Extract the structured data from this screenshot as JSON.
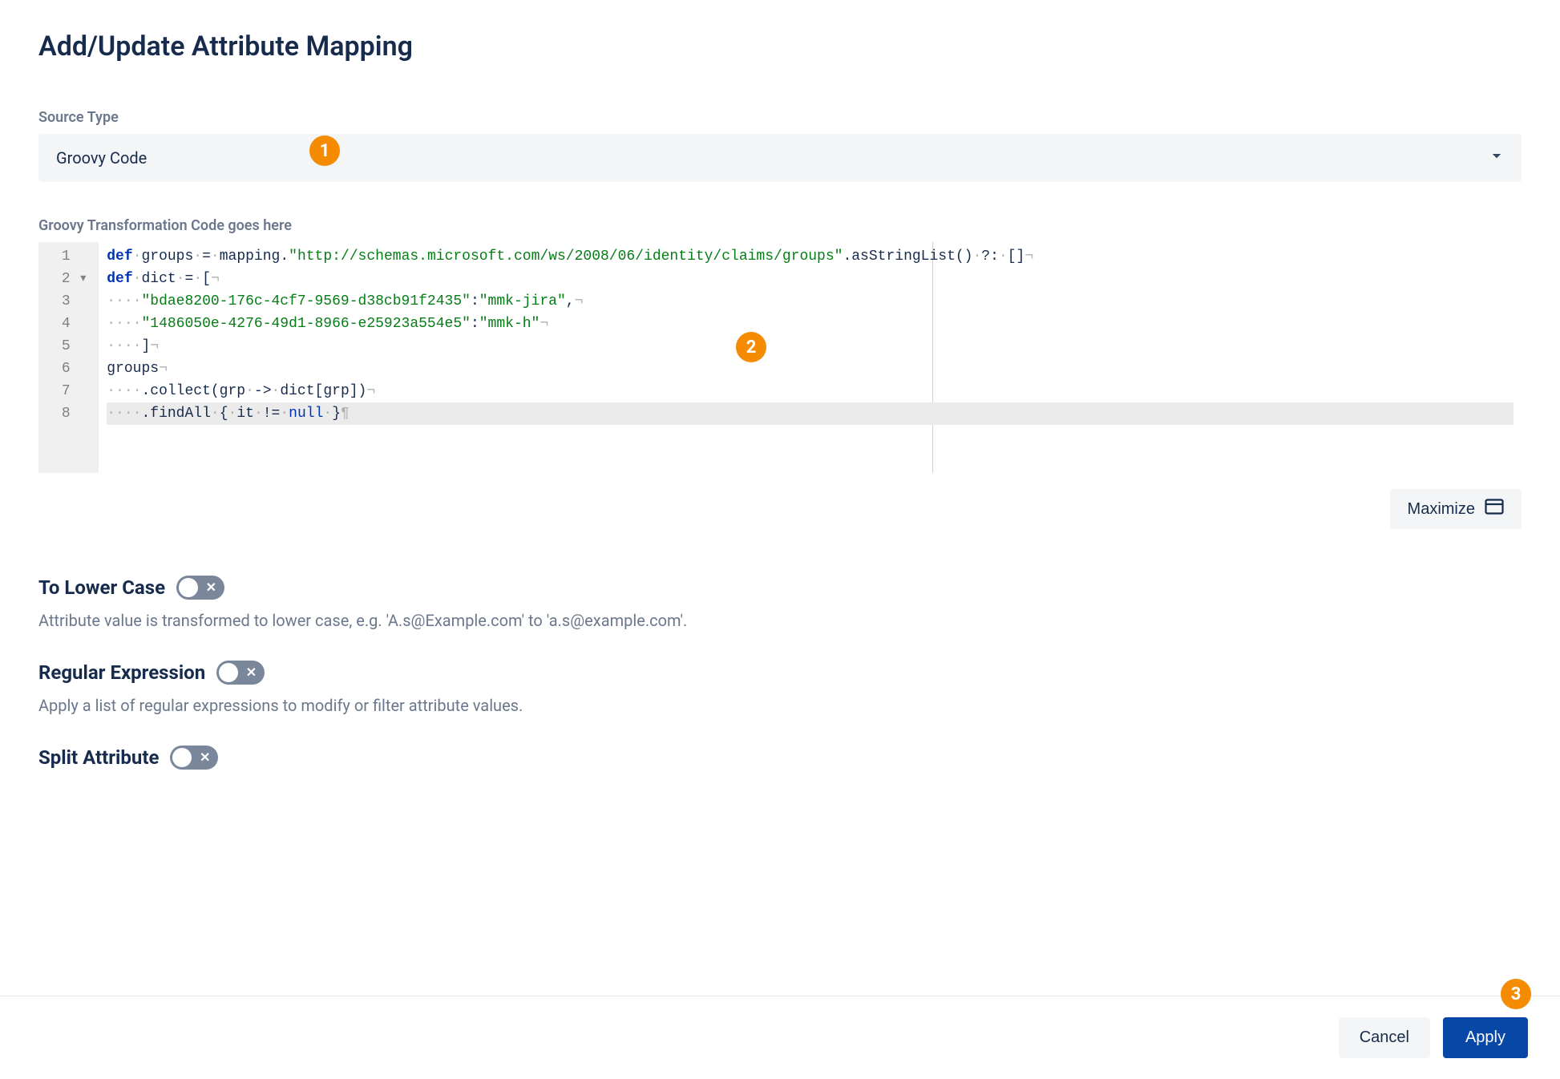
{
  "title": "Add/Update Attribute Mapping",
  "sourceType": {
    "label": "Source Type",
    "value": "Groovy Code"
  },
  "codeSection": {
    "label": "Groovy Transformation Code goes here",
    "lines": [
      {
        "n": 1,
        "tokens": [
          {
            "t": "def",
            "c": "tok-kw"
          },
          {
            "t": "·",
            "c": "tok-dim"
          },
          {
            "t": "groups",
            "c": "tok-var"
          },
          {
            "t": "·",
            "c": "tok-dim"
          },
          {
            "t": "=",
            "c": "tok-op"
          },
          {
            "t": "·",
            "c": "tok-dim"
          },
          {
            "t": "mapping.",
            "c": "tok-var"
          },
          {
            "t": "\"http://schemas.microsoft.com/ws/2008/06/identity/claims/groups\"",
            "c": "tok-str"
          },
          {
            "t": ".asStringList()",
            "c": "tok-var"
          },
          {
            "t": "·",
            "c": "tok-dim"
          },
          {
            "t": "?:",
            "c": "tok-op"
          },
          {
            "t": "·",
            "c": "tok-dim"
          },
          {
            "t": "[]",
            "c": "tok-op"
          },
          {
            "t": "¬",
            "c": "eol"
          }
        ]
      },
      {
        "n": 2,
        "fold": true,
        "tokens": [
          {
            "t": "def",
            "c": "tok-kw"
          },
          {
            "t": "·",
            "c": "tok-dim"
          },
          {
            "t": "dict",
            "c": "tok-var"
          },
          {
            "t": "·",
            "c": "tok-dim"
          },
          {
            "t": "=",
            "c": "tok-op"
          },
          {
            "t": "·",
            "c": "tok-dim"
          },
          {
            "t": "[",
            "c": "tok-op"
          },
          {
            "t": "¬",
            "c": "eol"
          }
        ]
      },
      {
        "n": 3,
        "tokens": [
          {
            "t": "····",
            "c": "tok-dim"
          },
          {
            "t": "\"bdae8200-176c-4cf7-9569-d38cb91f2435\"",
            "c": "tok-str"
          },
          {
            "t": ":",
            "c": "tok-op"
          },
          {
            "t": "\"mmk-jira\"",
            "c": "tok-str"
          },
          {
            "t": ",",
            "c": "tok-op"
          },
          {
            "t": "¬",
            "c": "eol"
          }
        ]
      },
      {
        "n": 4,
        "tokens": [
          {
            "t": "····",
            "c": "tok-dim"
          },
          {
            "t": "\"1486050e-4276-49d1-8966-e25923a554e5\"",
            "c": "tok-str"
          },
          {
            "t": ":",
            "c": "tok-op"
          },
          {
            "t": "\"mmk-h\"",
            "c": "tok-str"
          },
          {
            "t": "¬",
            "c": "eol"
          }
        ]
      },
      {
        "n": 5,
        "tokens": [
          {
            "t": "····",
            "c": "tok-dim"
          },
          {
            "t": "]",
            "c": "tok-op"
          },
          {
            "t": "¬",
            "c": "eol"
          }
        ]
      },
      {
        "n": 6,
        "tokens": [
          {
            "t": "groups",
            "c": "tok-var"
          },
          {
            "t": "¬",
            "c": "eol"
          }
        ]
      },
      {
        "n": 7,
        "tokens": [
          {
            "t": "····",
            "c": "tok-dim"
          },
          {
            "t": ".collect(grp",
            "c": "tok-var"
          },
          {
            "t": "·",
            "c": "tok-dim"
          },
          {
            "t": "->",
            "c": "tok-op"
          },
          {
            "t": "·",
            "c": "tok-dim"
          },
          {
            "t": "dict[grp])",
            "c": "tok-var"
          },
          {
            "t": "¬",
            "c": "eol"
          }
        ]
      },
      {
        "n": 8,
        "current": true,
        "tokens": [
          {
            "t": "····",
            "c": "tok-dim"
          },
          {
            "t": ".findAll",
            "c": "tok-var"
          },
          {
            "t": "·",
            "c": "tok-dim"
          },
          {
            "t": "{",
            "c": "tok-op"
          },
          {
            "t": "·",
            "c": "tok-dim"
          },
          {
            "t": "it",
            "c": "tok-var"
          },
          {
            "t": "·",
            "c": "tok-dim"
          },
          {
            "t": "!=",
            "c": "tok-op"
          },
          {
            "t": "·",
            "c": "tok-dim"
          },
          {
            "t": "null",
            "c": "tok-null"
          },
          {
            "t": "·",
            "c": "tok-dim"
          },
          {
            "t": "}",
            "c": "tok-op"
          },
          {
            "t": "¶",
            "c": "eol"
          }
        ]
      }
    ]
  },
  "maximizeLabel": "Maximize",
  "toggles": {
    "toLower": {
      "title": "To Lower Case",
      "desc": "Attribute value is transformed to lower case, e.g. 'A.s@Example.com' to 'a.s@example.com'."
    },
    "regex": {
      "title": "Regular Expression",
      "desc": "Apply a list of regular expressions to modify or filter attribute values."
    },
    "split": {
      "title": "Split Attribute"
    }
  },
  "footer": {
    "cancel": "Cancel",
    "apply": "Apply"
  },
  "callouts": {
    "one": "1",
    "two": "2",
    "three": "3"
  }
}
